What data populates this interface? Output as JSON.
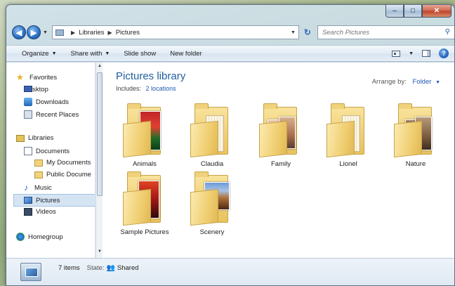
{
  "window": {
    "caption": {
      "minimize": "‒",
      "maximize": "□",
      "close": "✕"
    }
  },
  "address": {
    "back": "◀",
    "forward": "▶",
    "crumbs": [
      "Libraries",
      "Pictures"
    ],
    "search_placeholder": "Search Pictures"
  },
  "toolbar": {
    "organize": "Organize",
    "share_with": "Share with",
    "slide_show": "Slide show",
    "new_folder": "New folder"
  },
  "nav": {
    "favorites": "Favorites",
    "desktop": "Desktop",
    "downloads": "Downloads",
    "recent_places": "Recent Places",
    "libraries": "Libraries",
    "documents": "Documents",
    "my_documents": "My Documents",
    "public_documents": "Public Docume",
    "music": "Music",
    "pictures": "Pictures",
    "videos": "Videos",
    "homegroup": "Homegroup"
  },
  "library": {
    "title": "Pictures library",
    "includes_label": "Includes:",
    "includes_link": "2 locations",
    "arrange_label": "Arrange by:",
    "arrange_value": "Folder"
  },
  "folders": [
    {
      "name": "Animals"
    },
    {
      "name": "Claudia"
    },
    {
      "name": "Family"
    },
    {
      "name": "Lionel"
    },
    {
      "name": "Nature"
    },
    {
      "name": "Sample Pictures"
    },
    {
      "name": "Scenery"
    }
  ],
  "status": {
    "count": "7 items",
    "state_label": "State:",
    "state_value": "Shared"
  },
  "colors": {
    "link": "#1e56b3",
    "library_title": "#1f5f9f",
    "selection": "#d5e4f3"
  }
}
